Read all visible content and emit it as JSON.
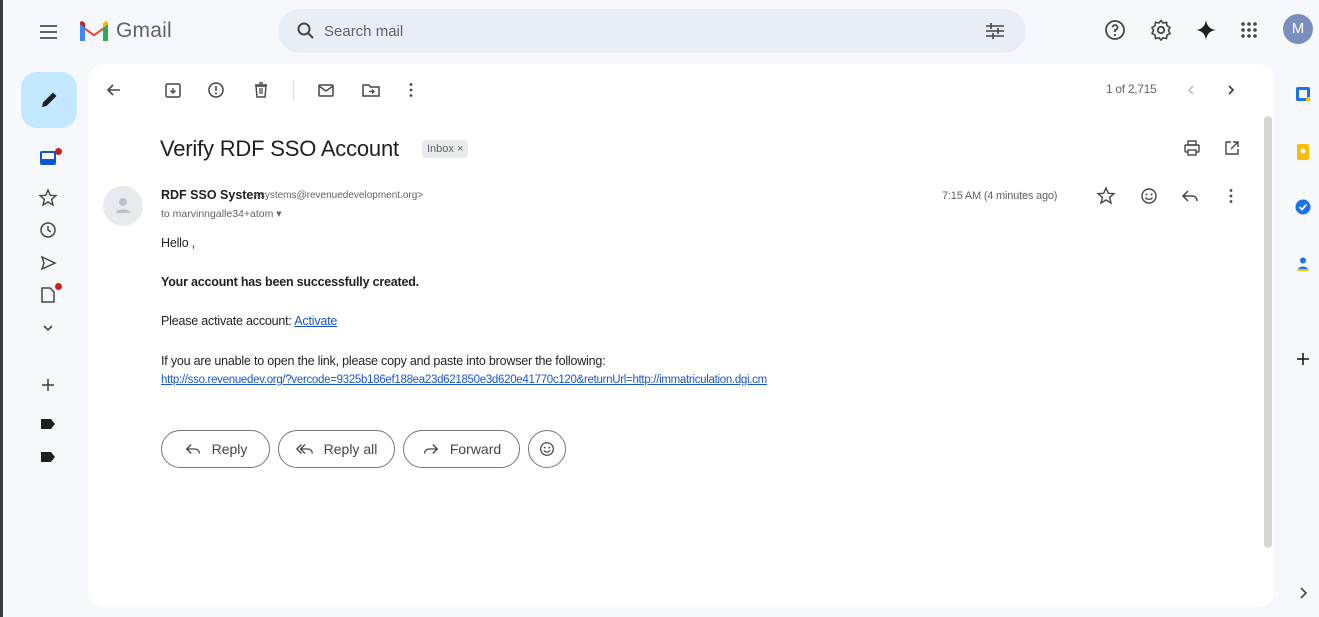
{
  "app": {
    "name": "Gmail"
  },
  "search": {
    "placeholder": "Search mail"
  },
  "user": {
    "avatar_initial": "M"
  },
  "toolbar": {
    "pager": "1 of 2,715"
  },
  "message": {
    "subject": "Verify RDF SSO Account",
    "label": "Inbox ×",
    "sender_name": "RDF SSO System",
    "sender_email": "<systems@revenuedevelopment.org>",
    "to": "to marvinngalle34+atom ▾",
    "timestamp": "7:15 AM (4 minutes ago)",
    "greeting": "Hello ,",
    "line_created": "Your account has been successfully created.",
    "line_activate_prefix": "Please activate account: ",
    "activate_link": "Activate",
    "line_copy": "If you are unable to open the link, please copy and paste into browser the following:",
    "long_url": "http://sso.revenuedev.org/?vercode=9325b186ef188ea23d621850e3d620e41770c120&returnUrl=http://immatriculation.dgi.cm"
  },
  "actions": {
    "reply": "Reply",
    "reply_all": "Reply all",
    "forward": "Forward"
  },
  "colors": {
    "compose_bg": "#c2e7ff",
    "link": "#1a56c8",
    "unread_dot": "#c5221f",
    "avatar_bg": "#7b8fbf"
  }
}
